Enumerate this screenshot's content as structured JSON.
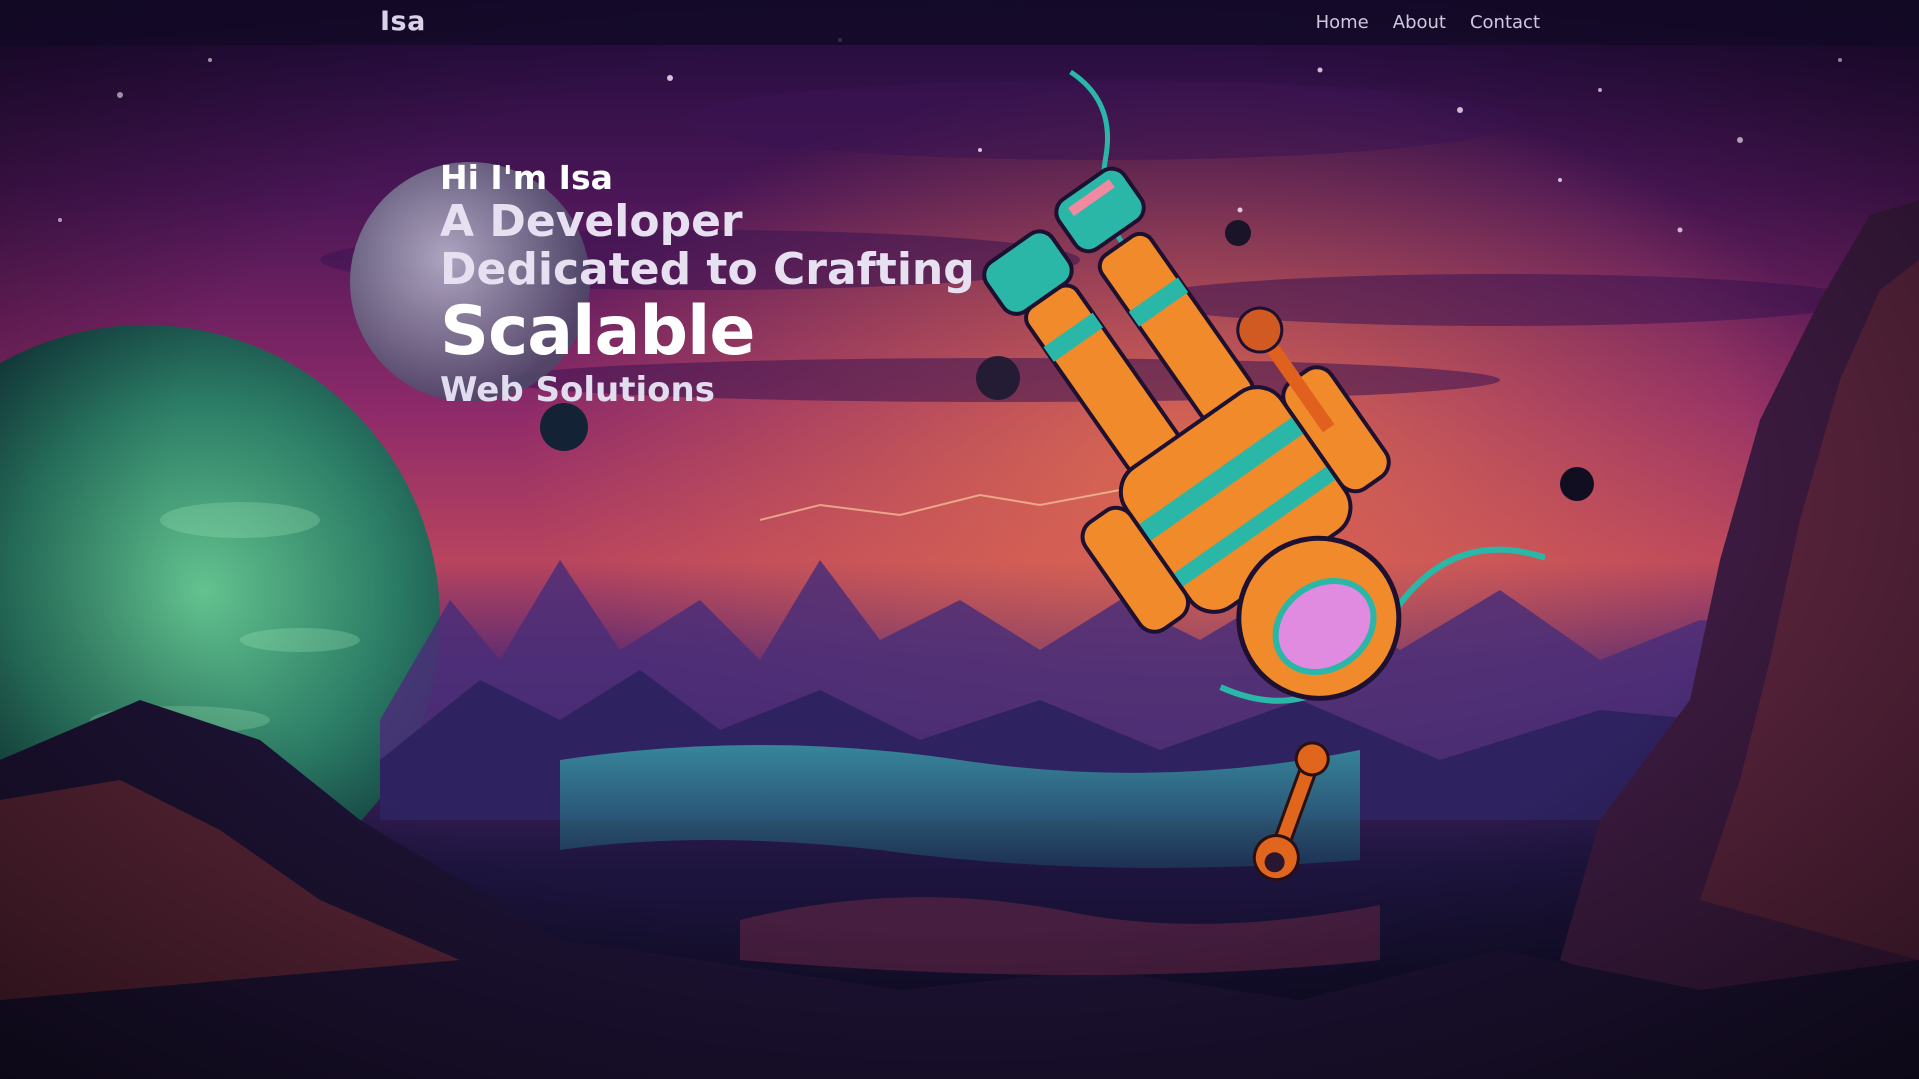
{
  "header": {
    "brand": "Isa",
    "nav": [
      {
        "label": "Home"
      },
      {
        "label": "About"
      },
      {
        "label": "Contact"
      }
    ]
  },
  "hero": {
    "greeting": "Hi I'm Isa",
    "line1": "A Developer",
    "line2": "Dedicated to Crafting",
    "highlight": "Scalable",
    "line3": "Web Solutions"
  },
  "colors": {
    "sky_top": "#2a0f45",
    "sky_mid": "#8a2a6e",
    "sky_glow": "#e0604e",
    "planet": "#2f8a68",
    "suit": "#f08a2a",
    "trim": "#2ab7a8"
  },
  "icons": {
    "astronaut": "astronaut-illustration",
    "wrench": "wrench-icon",
    "planet": "planet-illustration"
  }
}
